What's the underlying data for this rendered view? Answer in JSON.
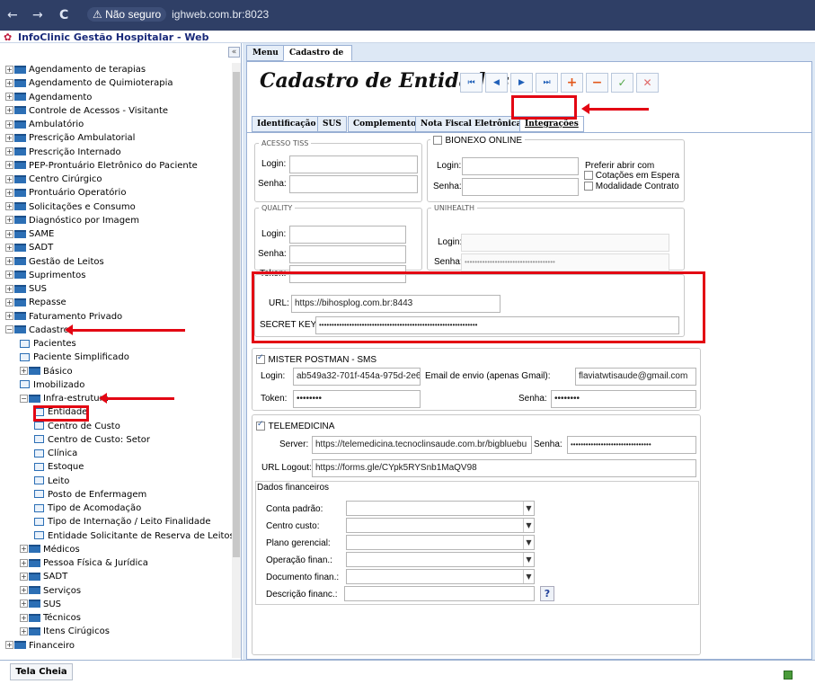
{
  "browser": {
    "nav_back": "←",
    "nav_forward": "→",
    "nav_reload": "C",
    "security_label": "Não seguro",
    "url": "ighweb.com.br:8023"
  },
  "app": {
    "title": "InfoClinic Gestão Hospitalar - Web"
  },
  "sidebar": {
    "collapse_label": "«",
    "items": [
      {
        "label": "Agendamento de terapias",
        "indent": 0,
        "type": "folder",
        "pm": "+"
      },
      {
        "label": "Agendamento de Quimioterapia",
        "indent": 0,
        "type": "folder",
        "pm": "+"
      },
      {
        "label": "Agendamento",
        "indent": 0,
        "type": "folder",
        "pm": "+"
      },
      {
        "label": "Controle de Acessos - Visitante",
        "indent": 0,
        "type": "folder",
        "pm": "+"
      },
      {
        "label": "Ambulatório",
        "indent": 0,
        "type": "folder",
        "pm": "+"
      },
      {
        "label": "Prescrição Ambulatorial",
        "indent": 0,
        "type": "folder",
        "pm": "+"
      },
      {
        "label": "Prescrição Internado",
        "indent": 0,
        "type": "folder",
        "pm": "+"
      },
      {
        "label": "PEP-Prontuário Eletrônico do Paciente",
        "indent": 0,
        "type": "folder",
        "pm": "+"
      },
      {
        "label": "Centro Cirúrgico",
        "indent": 0,
        "type": "folder",
        "pm": "+"
      },
      {
        "label": "Prontuário Operatório",
        "indent": 0,
        "type": "folder",
        "pm": "+"
      },
      {
        "label": "Solicitações e Consumo",
        "indent": 0,
        "type": "folder",
        "pm": "+"
      },
      {
        "label": "Diagnóstico por Imagem",
        "indent": 0,
        "type": "folder",
        "pm": "+"
      },
      {
        "label": "SAME",
        "indent": 0,
        "type": "folder",
        "pm": "+"
      },
      {
        "label": "SADT",
        "indent": 0,
        "type": "folder",
        "pm": "+"
      },
      {
        "label": "Gestão de Leitos",
        "indent": 0,
        "type": "folder",
        "pm": "+"
      },
      {
        "label": "Suprimentos",
        "indent": 0,
        "type": "folder",
        "pm": "+"
      },
      {
        "label": "SUS",
        "indent": 0,
        "type": "folder",
        "pm": "+"
      },
      {
        "label": "Repasse",
        "indent": 0,
        "type": "folder",
        "pm": "+"
      },
      {
        "label": "Faturamento Privado",
        "indent": 0,
        "type": "folder",
        "pm": "+"
      },
      {
        "label": "Cadastro",
        "indent": 0,
        "type": "folder",
        "pm": "−"
      },
      {
        "label": "Pacientes",
        "indent": 1,
        "type": "page"
      },
      {
        "label": "Paciente Simplificado",
        "indent": 1,
        "type": "page"
      },
      {
        "label": "Básico",
        "indent": 1,
        "type": "folder",
        "pm": "+"
      },
      {
        "label": "Imobilizado",
        "indent": 1,
        "type": "page"
      },
      {
        "label": "Infra-estrutura",
        "indent": 1,
        "type": "folder",
        "pm": "−"
      },
      {
        "label": "Entidade",
        "indent": 2,
        "type": "page",
        "selected": true
      },
      {
        "label": "Centro de Custo",
        "indent": 2,
        "type": "page"
      },
      {
        "label": "Centro de Custo: Setor",
        "indent": 2,
        "type": "page"
      },
      {
        "label": "Clínica",
        "indent": 2,
        "type": "page"
      },
      {
        "label": "Estoque",
        "indent": 2,
        "type": "page"
      },
      {
        "label": "Leito",
        "indent": 2,
        "type": "page"
      },
      {
        "label": "Posto de Enfermagem",
        "indent": 2,
        "type": "page"
      },
      {
        "label": "Tipo de Acomodação",
        "indent": 2,
        "type": "page"
      },
      {
        "label": "Tipo de Internação / Leito Finalidade",
        "indent": 2,
        "type": "page"
      },
      {
        "label": "Entidade Solicitante de Reserva de Leitos",
        "indent": 2,
        "type": "page"
      },
      {
        "label": "Médicos",
        "indent": 1,
        "type": "folder",
        "pm": "+"
      },
      {
        "label": "Pessoa Física & Jurídica",
        "indent": 1,
        "type": "folder",
        "pm": "+"
      },
      {
        "label": "SADT",
        "indent": 1,
        "type": "folder",
        "pm": "+"
      },
      {
        "label": "Serviços",
        "indent": 1,
        "type": "folder",
        "pm": "+"
      },
      {
        "label": "SUS",
        "indent": 1,
        "type": "folder",
        "pm": "+"
      },
      {
        "label": "Técnicos",
        "indent": 1,
        "type": "folder",
        "pm": "+"
      },
      {
        "label": "Itens Cirúgicos",
        "indent": 1,
        "type": "folder",
        "pm": "+"
      },
      {
        "label": "Financeiro",
        "indent": 0,
        "type": "folder",
        "pm": "+"
      }
    ]
  },
  "footer": {
    "fullscreen_label": "Tela Cheia"
  },
  "main": {
    "tabs": [
      {
        "label": "Menu"
      },
      {
        "label": "Cadastro de Entidades",
        "close": "✕"
      }
    ],
    "page_title": "Cadastro de Entidades",
    "nav_buttons": {
      "first": "⏮",
      "prev": "◀",
      "next": "▶",
      "last": "⏭",
      "add": "+",
      "remove": "−",
      "confirm": "✓",
      "cancel": "✕"
    },
    "colors": {
      "first": "#1f5fb8",
      "prev": "#1f5fb8",
      "next": "#1f5fb8",
      "last": "#1f5fb8",
      "add": "#e2571b",
      "remove": "#e2571b",
      "confirm": "#56a84a",
      "cancel": "#e06a6a"
    },
    "subtabs": [
      {
        "label": "Identificação"
      },
      {
        "label": "SUS"
      },
      {
        "label": "Complemento"
      },
      {
        "label": "Nota Fiscal Eletrônica"
      },
      {
        "label": "Integrações",
        "active": true
      }
    ],
    "acesso_tiss": {
      "legend": "ACESSO TISS",
      "login_label": "Login:",
      "senha_label": "Senha:"
    },
    "bionexo": {
      "label": "BIONEXO ONLINE",
      "login_label": "Login:",
      "senha_label": "Senha:",
      "prefer_label": "Preferir abrir com",
      "cotacoes_label": "Cotações em Espera",
      "modalidade_label": "Modalidade Contrato"
    },
    "quality": {
      "legend": "QUALITY",
      "login_label": "Login:",
      "senha_label": "Senha:",
      "token_label": "Token:"
    },
    "unihealth": {
      "legend": "UNIHEALTH",
      "login_label": "Login:",
      "senha_label": "Senha:",
      "senha_value": "••••••••••••••••••••••••••••••••••••"
    },
    "secret": {
      "url_label": "URL:",
      "url_value": "https://bihosplog.com.br:8443",
      "key_label": "SECRET KEY",
      "key_value": "•••••••••••••••••••••••••••••••••••••••••••••••••••••••••••••••"
    },
    "postman": {
      "label": "MISTER POSTMAN - SMS",
      "login_label": "Login:",
      "login_value": "ab549a32-701f-454a-975d-2e6",
      "email_label": "Email de envio (apenas Gmail):",
      "email_value": "flaviatwtisaude@gmail.com",
      "token_label": "Token:",
      "token_value": "••••••••",
      "senha_label": "Senha:",
      "senha_value": "••••••••"
    },
    "telemedicina": {
      "label": "TELEMEDICINA",
      "server_label": "Server:",
      "server_value": "https://telemedicina.tecnoclinsaude.com.br/bigbluebu",
      "senha_label": "Senha:",
      "senha_value": "••••••••••••••••••••••••••••••••",
      "logout_label": "URL Logout:",
      "logout_value": "https://forms.gle/CYpk5RYSnb1MaQV98"
    },
    "financeiro": {
      "title": "Dados financeiros",
      "conta_label": "Conta padrão:",
      "centro_label": "Centro custo:",
      "plano_label": "Plano gerencial:",
      "operacao_label": "Operação finan.:",
      "documento_label": "Documento finan.:",
      "descricao_label": "Descrição financ.:",
      "help_label": "?"
    }
  },
  "annotation_color": "#e30613"
}
